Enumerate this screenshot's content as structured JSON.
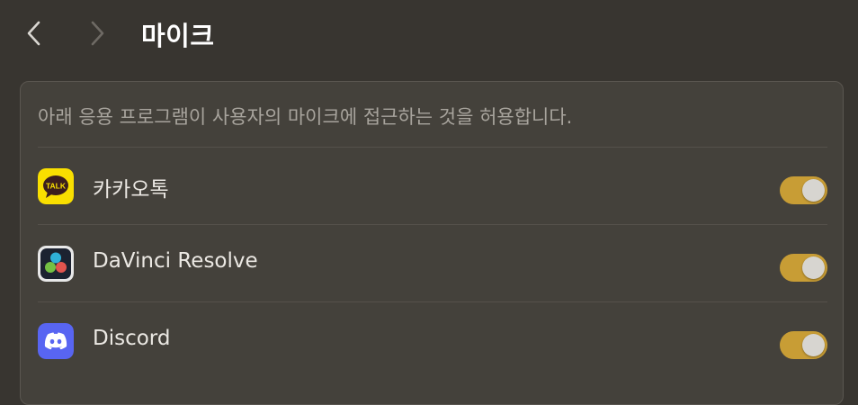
{
  "header": {
    "title": "마이크",
    "back_icon": "chevron-left-icon",
    "forward_icon": "chevron-right-icon"
  },
  "panel": {
    "description": "아래 응용 프로그램이 사용자의 마이크에 접근하는 것을 허용합니다.",
    "apps": [
      {
        "name": "카카오톡",
        "icon": "kakaotalk-icon",
        "enabled": true
      },
      {
        "name": "DaVinci Resolve",
        "icon": "davinci-resolve-icon",
        "enabled": true
      },
      {
        "name": "Discord",
        "icon": "discord-icon",
        "enabled": true
      }
    ]
  },
  "colors": {
    "background": "#383530",
    "panel": "#44413b",
    "toggle_on": "#c89d35"
  }
}
